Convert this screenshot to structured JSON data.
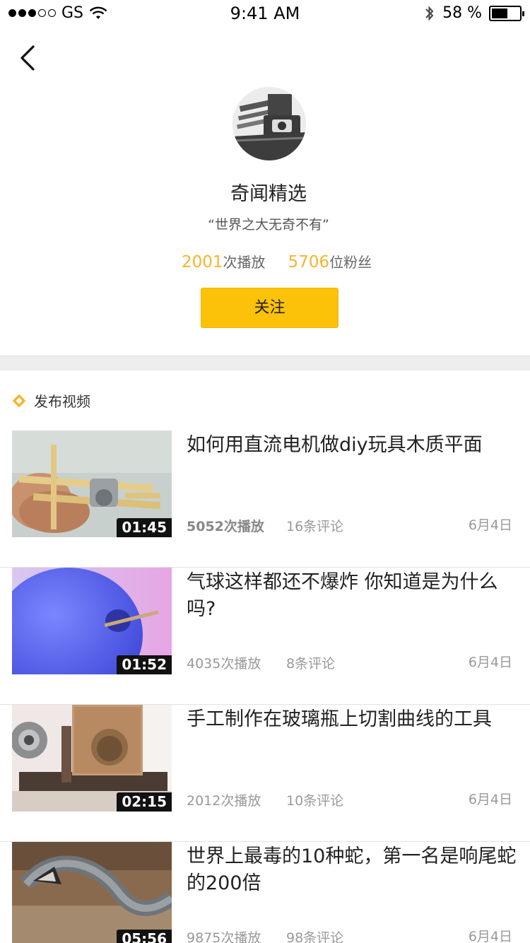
{
  "status_bar": {
    "carrier": "GS",
    "time": "9:41 AM",
    "battery_percent": "58 %",
    "battery_level": 0.58,
    "signal_bars_filled": 3,
    "signal_bars_total": 5
  },
  "header": {
    "channel_name": "奇闻精选",
    "motto": "“世界之大无奇不有”",
    "plays_count": "2001",
    "plays_label": "次播放",
    "fans_count": "5706",
    "fans_label": "位粉丝",
    "follow_label": "关注"
  },
  "section": {
    "title": "发布视频"
  },
  "videos": [
    {
      "title": "如何用直流电机做diy玩具木质平面",
      "duration": "01:45",
      "plays": "5052次播放",
      "comments": "16条评论",
      "date": "6月4日"
    },
    {
      "title": "气球这样都还不爆炸  你知道是为什么吗?",
      "duration": "01:52",
      "plays": "4035次播放",
      "comments": "8条评论",
      "date": "6月4日"
    },
    {
      "title": "手工制作在玻璃瓶上切割曲线的工具",
      "duration": "02:15",
      "plays": "2012次播放",
      "comments": "10条评论",
      "date": "6月4日"
    },
    {
      "title": "世界上最毒的10种蛇，第一名是响尾蛇的200倍",
      "duration": "05:56",
      "plays": "9875次播放",
      "comments": "98条评论",
      "date": "6月4日"
    }
  ],
  "colors": {
    "accent": "#fcc20a",
    "stat_number": "#f5b52c",
    "divider": "#eeeeee"
  }
}
